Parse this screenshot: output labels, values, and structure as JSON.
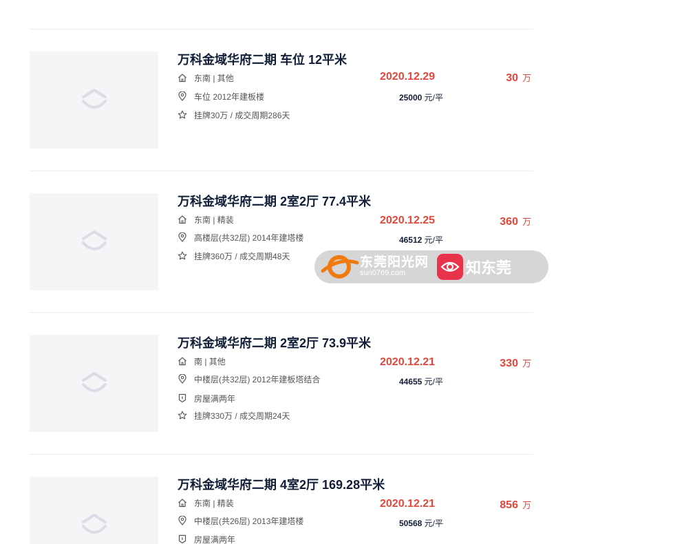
{
  "listings": [
    {
      "title": "万科金域华府二期 车位 12平米",
      "orientation": "东南 | 其他",
      "floor": "车位 2012年建板楼",
      "extra": "",
      "listing": "挂牌30万 / 成交周期286天",
      "deal_date": "2020.12.29",
      "unit_price_value": "25000",
      "unit_price_unit": "元/平",
      "total_price": "30",
      "total_unit": "万"
    },
    {
      "title": "万科金域华府二期 2室2厅 77.4平米",
      "orientation": "东南 | 精装",
      "floor": "高楼层(共32层) 2014年建塔楼",
      "extra": "",
      "listing": "挂牌360万 / 成交周期48天",
      "deal_date": "2020.12.25",
      "unit_price_value": "46512",
      "unit_price_unit": "元/平",
      "total_price": "360",
      "total_unit": "万"
    },
    {
      "title": "万科金域华府二期 2室2厅 73.9平米",
      "orientation": "南 | 其他",
      "floor": "中楼层(共32层) 2012年建板塔结合",
      "extra": "房屋满两年",
      "listing": "挂牌330万 / 成交周期24天",
      "deal_date": "2020.12.21",
      "unit_price_value": "44655",
      "unit_price_unit": "元/平",
      "total_price": "330",
      "total_unit": "万"
    },
    {
      "title": "万科金域华府二期 4室2厅 169.28平米",
      "orientation": "东南 | 精装",
      "floor": "中楼层(共26层) 2013年建塔楼",
      "extra": "房屋满两年",
      "listing": "",
      "deal_date": "2020.12.21",
      "unit_price_value": "50568",
      "unit_price_unit": "元/平",
      "total_price": "856",
      "total_unit": "万"
    }
  ],
  "watermark": {
    "site_name": "东莞阳光网",
    "site_url": "sun0769.com",
    "app_name": "知东莞"
  },
  "colors": {
    "title": "#101d37",
    "price_red": "#e3463b",
    "divider": "#ececec",
    "thumb_bg": "#f5f5f7"
  },
  "icons": [
    "house-icon",
    "location-pin-icon",
    "shield-tag-icon",
    "star-icon",
    "placeholder-logo-icon"
  ]
}
